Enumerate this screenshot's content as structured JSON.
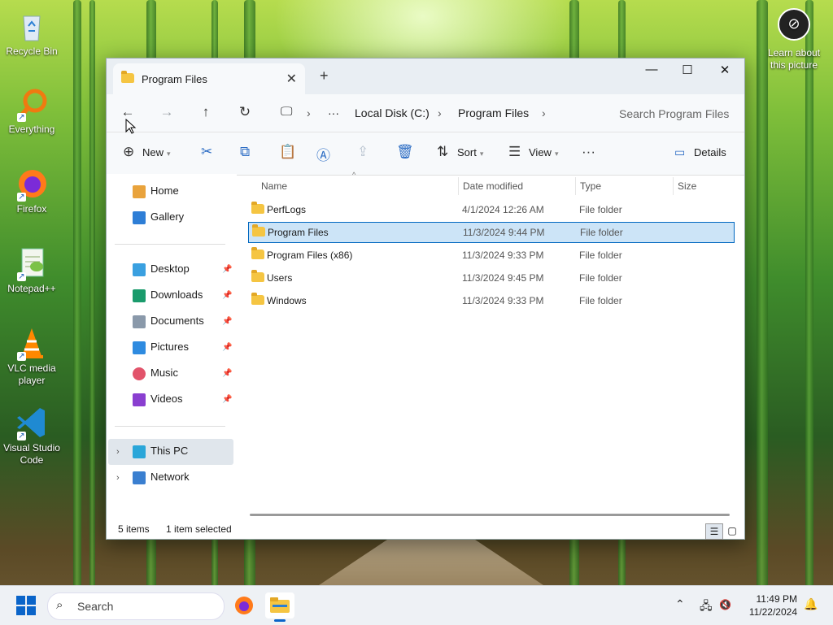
{
  "desktop": {
    "icons": [
      {
        "label": "Recycle Bin"
      },
      {
        "label": "Everything"
      },
      {
        "label": "Firefox"
      },
      {
        "label": "Notepad++"
      },
      {
        "label": "VLC media player"
      },
      {
        "label": "Visual Studio Code"
      }
    ],
    "learn": "Learn about this picture"
  },
  "window": {
    "tab_title": "Program Files",
    "new_tab": "+",
    "controls": {
      "minimize": "—",
      "maximize": "☐",
      "close": "✕"
    }
  },
  "address": {
    "more": "···",
    "crumbs": [
      "Local Disk (C:)",
      "Program Files"
    ],
    "search_placeholder": "Search Program Files"
  },
  "toolbar": {
    "new_label": "New",
    "sort_label": "Sort",
    "view_label": "View",
    "details_label": "Details"
  },
  "sidebar": {
    "home": "Home",
    "gallery": "Gallery",
    "quick": [
      {
        "label": "Desktop"
      },
      {
        "label": "Downloads"
      },
      {
        "label": "Documents"
      },
      {
        "label": "Pictures"
      },
      {
        "label": "Music"
      },
      {
        "label": "Videos"
      }
    ],
    "this_pc": "This PC",
    "network": "Network"
  },
  "columns": {
    "name": "Name",
    "date": "Date modified",
    "type": "Type",
    "size": "Size"
  },
  "files": [
    {
      "name": "PerfLogs",
      "date": "4/1/2024 12:26 AM",
      "type": "File folder"
    },
    {
      "name": "Program Files",
      "date": "11/3/2024 9:44 PM",
      "type": "File folder"
    },
    {
      "name": "Program Files (x86)",
      "date": "11/3/2024 9:33 PM",
      "type": "File folder"
    },
    {
      "name": "Users",
      "date": "11/3/2024 9:45 PM",
      "type": "File folder"
    },
    {
      "name": "Windows",
      "date": "11/3/2024 9:33 PM",
      "type": "File folder"
    }
  ],
  "status": {
    "count": "5 items",
    "selected": "1 item selected"
  },
  "taskbar": {
    "search_placeholder": "Search",
    "time": "11:49 PM",
    "date": "11/22/2024"
  },
  "colors": {
    "accent": "#0067c0",
    "selection": "#cce4f7"
  }
}
